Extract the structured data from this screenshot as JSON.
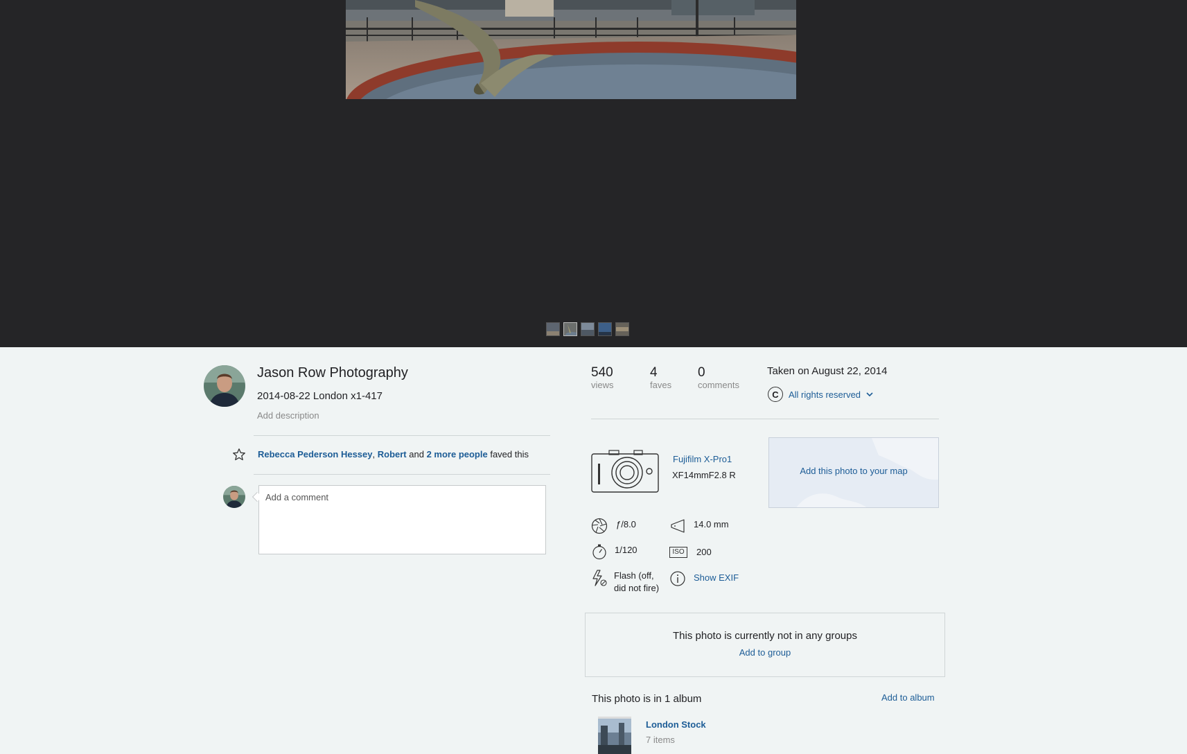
{
  "owner": {
    "name": "Jason Row Photography",
    "photo_title": "2014-08-22 London x1-417",
    "add_description": "Add description"
  },
  "faves_line": {
    "user1": "Rebecca Pederson Hessey",
    "sep": ",",
    "user2": "Robert",
    "and": "and",
    "more": "2 more people",
    "suffix": "faved this"
  },
  "comment": {
    "placeholder": "Add a comment"
  },
  "stats": {
    "views": {
      "value": "540",
      "label": "views"
    },
    "faves": {
      "value": "4",
      "label": "faves"
    },
    "comments": {
      "value": "0",
      "label": "comments"
    }
  },
  "taken": "Taken on August 22, 2014",
  "license": {
    "icon": "C",
    "label": "All rights reserved"
  },
  "camera": {
    "model": "Fujifilm X-Pro1",
    "lens": "XF14mmF2.8 R"
  },
  "map": {
    "label": "Add this photo to your map"
  },
  "exif": {
    "aperture": "ƒ/8.0",
    "focal_length": "14.0 mm",
    "shutter": "1/120",
    "iso": "200",
    "flash_line1": "Flash (off,",
    "flash_line2": "did not fire)",
    "show_exif": "Show EXIF",
    "iso_icon": "ISO"
  },
  "groups": {
    "message": "This photo is currently not in any groups",
    "add": "Add to group"
  },
  "albums": {
    "count_text": "This photo is in 1 album",
    "add": "Add to album",
    "items": [
      {
        "name": "London Stock",
        "count": "7 items"
      }
    ]
  },
  "colors": {
    "stage_bg": "#252527",
    "page_bg": "#f0f4f4",
    "link": "#1c5c96",
    "muted": "#898989"
  }
}
